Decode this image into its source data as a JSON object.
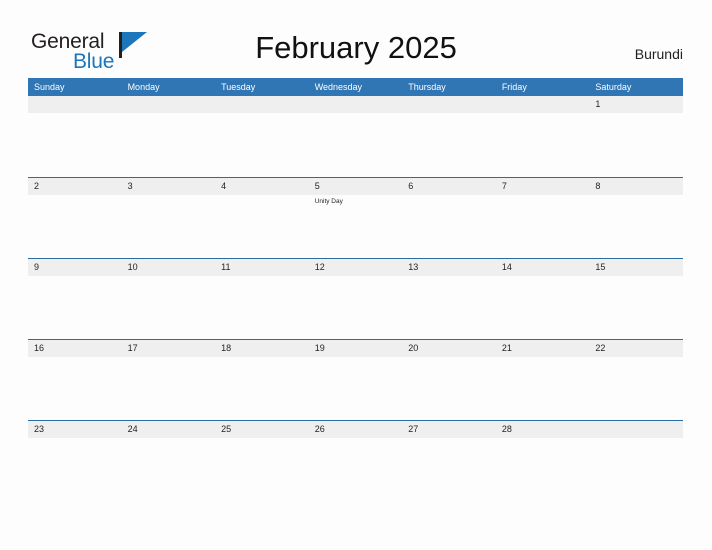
{
  "brand": {
    "name_part1": "General",
    "name_part2": "Blue",
    "flag_icon": "flag-triangle-icon",
    "accent_color": "#1c76bc"
  },
  "header": {
    "title": "February 2025",
    "country": "Burundi"
  },
  "theme": {
    "header_bg": "#3075b4",
    "header_text": "#ffffff",
    "week_band_bg": "#efefef",
    "week_border": "#2b6ca3",
    "page_bg": "#fdfdfd",
    "text_color": "#231f20"
  },
  "calendar": {
    "month": "February",
    "year": "2025",
    "weekday_headers": [
      "Sunday",
      "Monday",
      "Tuesday",
      "Wednesday",
      "Thursday",
      "Friday",
      "Saturday"
    ],
    "weeks": [
      {
        "days": [
          {
            "num": "",
            "events": []
          },
          {
            "num": "",
            "events": []
          },
          {
            "num": "",
            "events": []
          },
          {
            "num": "",
            "events": []
          },
          {
            "num": "",
            "events": []
          },
          {
            "num": "",
            "events": []
          },
          {
            "num": "1",
            "events": []
          }
        ]
      },
      {
        "days": [
          {
            "num": "2",
            "events": []
          },
          {
            "num": "3",
            "events": []
          },
          {
            "num": "4",
            "events": []
          },
          {
            "num": "5",
            "events": [
              "Unity Day"
            ]
          },
          {
            "num": "6",
            "events": []
          },
          {
            "num": "7",
            "events": []
          },
          {
            "num": "8",
            "events": []
          }
        ]
      },
      {
        "days": [
          {
            "num": "9",
            "events": []
          },
          {
            "num": "10",
            "events": []
          },
          {
            "num": "11",
            "events": []
          },
          {
            "num": "12",
            "events": []
          },
          {
            "num": "13",
            "events": []
          },
          {
            "num": "14",
            "events": []
          },
          {
            "num": "15",
            "events": []
          }
        ]
      },
      {
        "days": [
          {
            "num": "16",
            "events": []
          },
          {
            "num": "17",
            "events": []
          },
          {
            "num": "18",
            "events": []
          },
          {
            "num": "19",
            "events": []
          },
          {
            "num": "20",
            "events": []
          },
          {
            "num": "21",
            "events": []
          },
          {
            "num": "22",
            "events": []
          }
        ]
      },
      {
        "days": [
          {
            "num": "23",
            "events": []
          },
          {
            "num": "24",
            "events": []
          },
          {
            "num": "25",
            "events": []
          },
          {
            "num": "26",
            "events": []
          },
          {
            "num": "27",
            "events": []
          },
          {
            "num": "28",
            "events": []
          },
          {
            "num": "",
            "events": []
          }
        ]
      }
    ]
  }
}
